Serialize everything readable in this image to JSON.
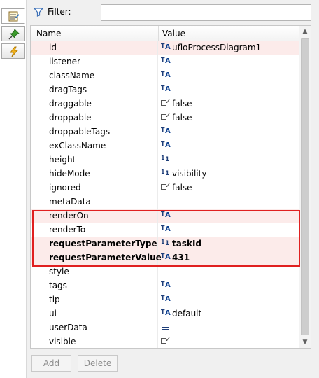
{
  "filter": {
    "label": "Filter:",
    "value": "",
    "placeholder": ""
  },
  "grid": {
    "columns": [
      "Name",
      "Value"
    ],
    "rows": [
      {
        "name": "id",
        "type": "string",
        "value": "ufloProcessDiagram1",
        "selected": true
      },
      {
        "name": "listener",
        "type": "string",
        "value": ""
      },
      {
        "name": "className",
        "type": "string",
        "value": ""
      },
      {
        "name": "dragTags",
        "type": "string",
        "value": ""
      },
      {
        "name": "draggable",
        "type": "boolean",
        "value": "false"
      },
      {
        "name": "droppable",
        "type": "boolean",
        "value": "false"
      },
      {
        "name": "droppableTags",
        "type": "string",
        "value": ""
      },
      {
        "name": "exClassName",
        "type": "string",
        "value": ""
      },
      {
        "name": "height",
        "type": "number",
        "value": ""
      },
      {
        "name": "hideMode",
        "type": "number",
        "value": "visibility"
      },
      {
        "name": "ignored",
        "type": "boolean",
        "value": "false"
      },
      {
        "name": "metaData",
        "type": "none",
        "value": ""
      },
      {
        "name": "renderOn",
        "type": "string",
        "value": "",
        "selected": true
      },
      {
        "name": "renderTo",
        "type": "string",
        "value": ""
      },
      {
        "name": "requestParameterType",
        "type": "number",
        "value": "taskId",
        "bold": true,
        "selected": true
      },
      {
        "name": "requestParameterValue",
        "type": "string",
        "value": "431",
        "bold": true,
        "selected": true
      },
      {
        "name": "style",
        "type": "none",
        "value": ""
      },
      {
        "name": "tags",
        "type": "string",
        "value": ""
      },
      {
        "name": "tip",
        "type": "string",
        "value": ""
      },
      {
        "name": "ui",
        "type": "string",
        "value": "default"
      },
      {
        "name": "userData",
        "type": "list",
        "value": ""
      },
      {
        "name": "visible",
        "type": "boolean",
        "value": ""
      }
    ]
  },
  "buttons": {
    "add": "Add",
    "delete": "Delete"
  },
  "colors": {
    "highlight": "#e02020",
    "selected_row": "#fcebea",
    "accent": "#1f3f7a"
  },
  "icons": [
    "properties-tab-icon",
    "pin-tab-icon",
    "events-tab-icon",
    "filter-icon"
  ]
}
